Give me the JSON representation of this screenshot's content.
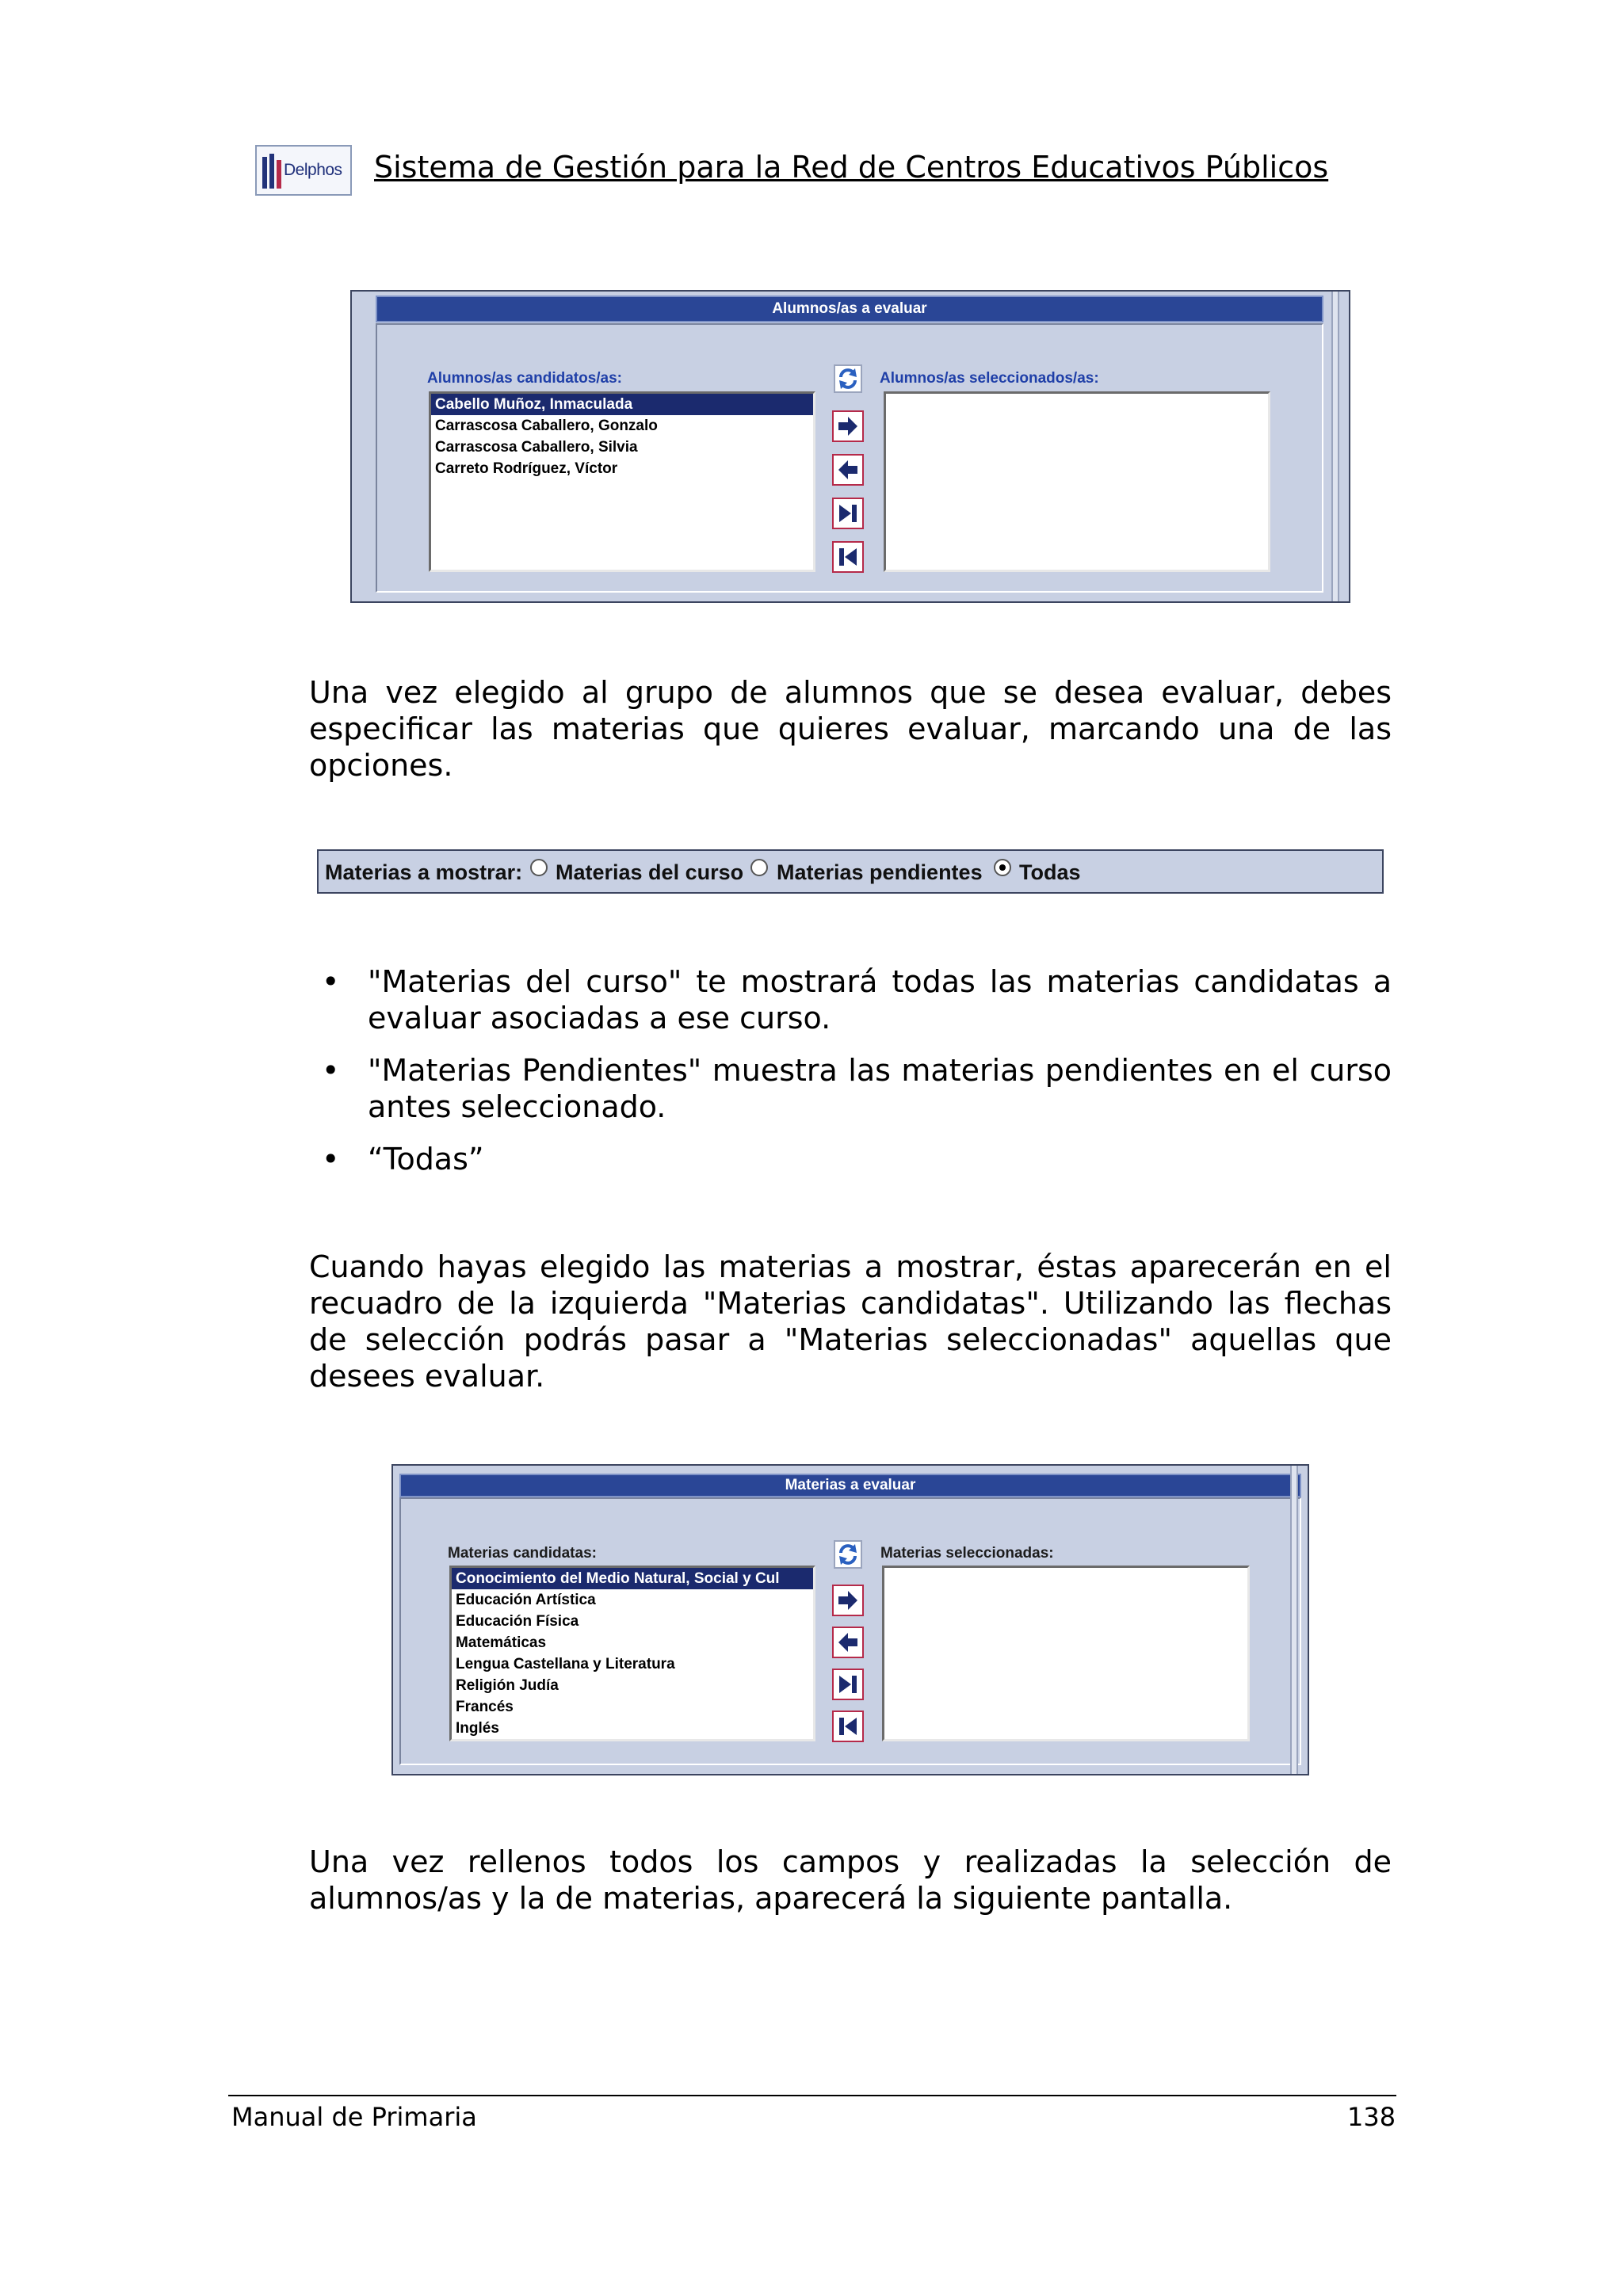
{
  "header": {
    "logo_text": "Delphos",
    "title": "Sistema de Gestión para la Red de Centros Educativos Públicos"
  },
  "shot_students": {
    "title": "Alumnos/as a evaluar",
    "candidates_label": "Alumnos/as candidatos/as:",
    "selected_label": "Alumnos/as seleccionados/as:",
    "candidates": [
      "Cabello Muñoz, Inmaculada",
      "Carrascosa Caballero, Gonzalo",
      "Carrascosa Caballero, Silvia",
      "Carreto Rodríguez, Víctor"
    ],
    "selected_index": 0,
    "selected": []
  },
  "paragraphs": {
    "p1": "Una vez elegido al grupo de alumnos que se desea evaluar, debes especificar las materias que quieres evaluar, marcando una de las opciones.",
    "p2": "Cuando hayas elegido las materias a mostrar, éstas aparecerán en el recuadro de la izquierda \"Materias candidatas\". Utilizando las flechas de selección podrás pasar a \"Materias seleccionadas\" aquellas que desees evaluar.",
    "p3": "Una vez rellenos todos los campos y realizadas la selección de alumnos/as y la de materias, aparecerá la siguiente pantalla."
  },
  "radio_strip": {
    "label": "Materias a mostrar:",
    "options": [
      "Materias del curso",
      "Materias pendientes",
      "Todas"
    ],
    "checked": "Todas"
  },
  "bullets": [
    "\"Materias del curso\" te mostrará todas las materias candidatas a evaluar asociadas a ese curso.",
    "\"Materias Pendientes\" muestra las materias pendientes en el curso antes seleccionado.",
    "“Todas”"
  ],
  "shot_subjects": {
    "title": "Materias a evaluar",
    "candidates_label": "Materias candidatas:",
    "selected_label": "Materias seleccionadas:",
    "candidates": [
      "Conocimiento del Medio Natural, Social y Cul",
      "Educación Artística",
      "Educación Física",
      "Matemáticas",
      "Lengua Castellana y Literatura",
      "Religión Judía",
      "Francés",
      "Inglés"
    ],
    "selected_index": 0,
    "selected": []
  },
  "footer": {
    "left": "Manual de Primaria",
    "page_number": "138"
  },
  "icons": [
    "refresh-icon",
    "arrow-right-icon",
    "arrow-left-icon",
    "move-all-right-icon",
    "move-all-left-icon"
  ],
  "colors": {
    "panel_bg": "#c8d0e3",
    "title_bar": "#2a4696",
    "selection": "#1b2a6e",
    "blue_label": "#1f3fa8",
    "button_border": "#b52a4a"
  }
}
